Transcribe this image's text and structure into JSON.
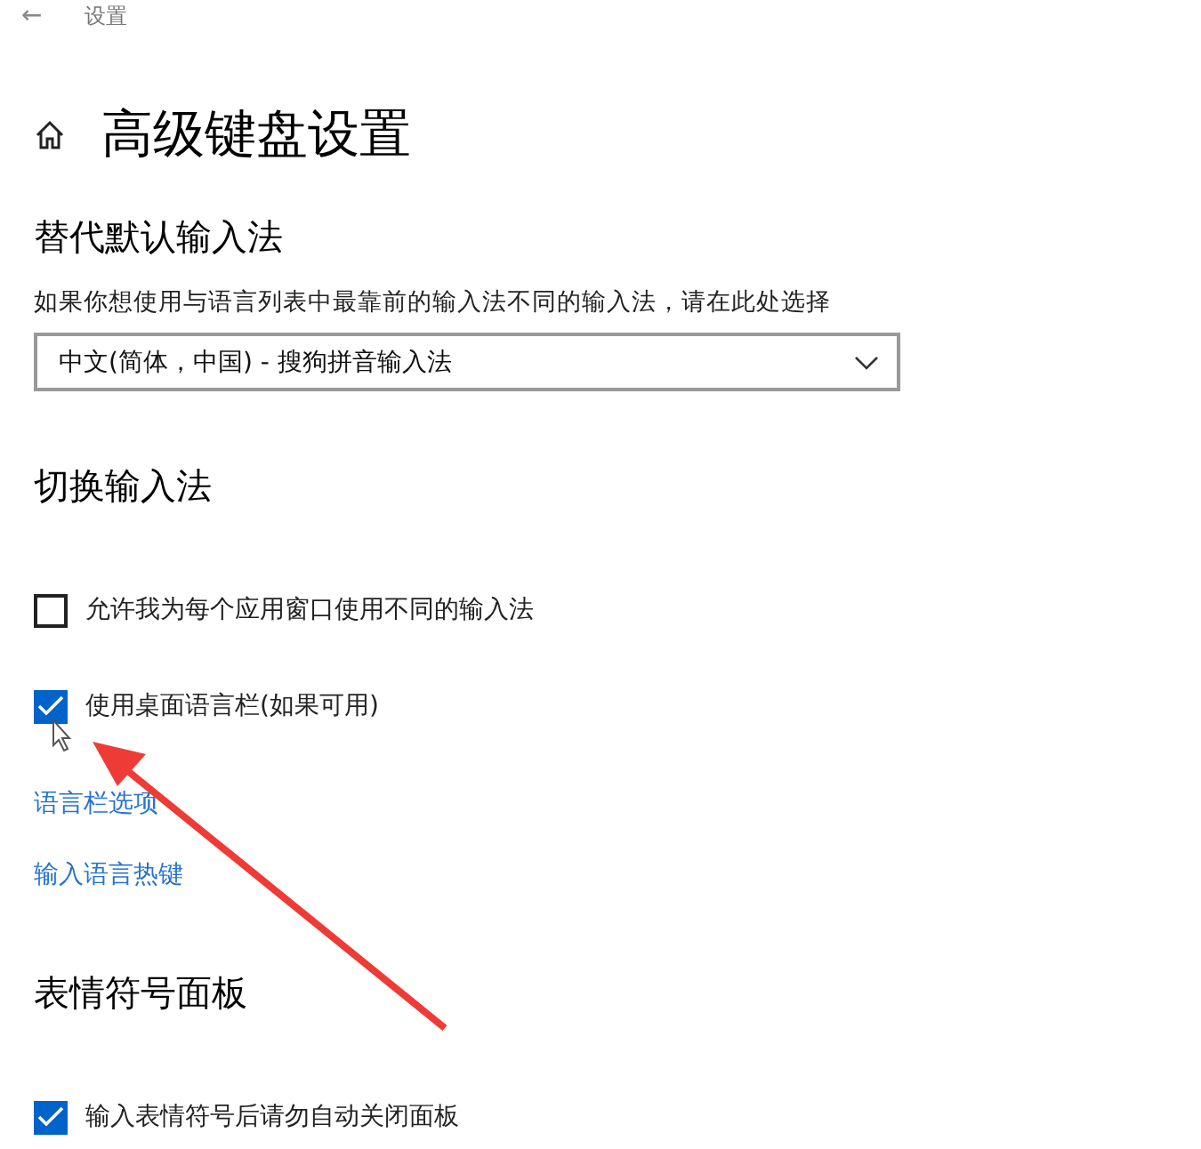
{
  "window": {
    "back": "←",
    "title": "设置"
  },
  "page": {
    "title": "高级键盘设置"
  },
  "sections": [
    {
      "heading": "替代默认输入法",
      "items": [
        {
          "kind": "text",
          "label": "如果你想使用与语言列表中最靠前的输入法不同的输入法，请在此处选择"
        },
        {
          "kind": "dropdown",
          "value": "中文(简体，中国) - 搜狗拼音输入法"
        }
      ]
    },
    {
      "heading": "切换输入法",
      "items": [
        {
          "kind": "checkbox",
          "label": "允许我为每个应用窗口使用不同的输入法",
          "checked": false
        },
        {
          "kind": "checkbox",
          "label": "使用桌面语言栏(如果可用)",
          "checked": true
        },
        {
          "kind": "link",
          "label": "语言栏选项"
        },
        {
          "kind": "link",
          "label": "输入语言热键"
        }
      ]
    },
    {
      "heading": "表情符号面板",
      "items": [
        {
          "kind": "checkbox",
          "label": "输入表情符号后请勿自动关闭面板",
          "checked": true
        }
      ]
    }
  ],
  "annotation": {
    "kind": "arrow",
    "color": "#ef3b36"
  }
}
